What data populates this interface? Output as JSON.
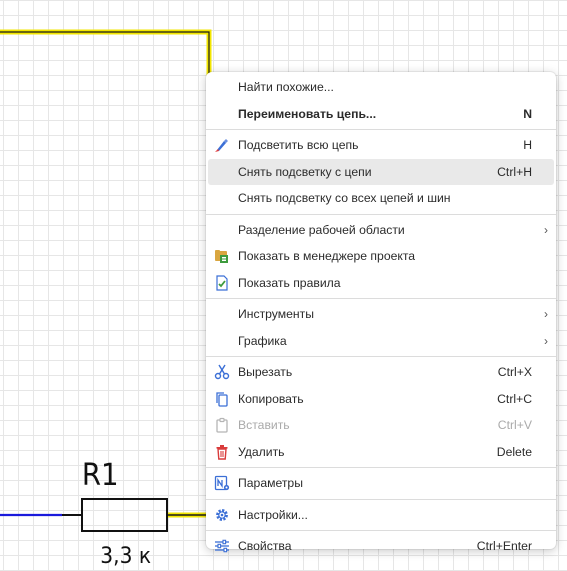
{
  "schematic": {
    "component_designator": "R1",
    "component_value": "3,3 к",
    "wire_highlight_color": "#f2e600",
    "wire_color_dark": "#1a1a1a",
    "net_color_blue": "#1a1adc"
  },
  "menu": {
    "find_similar": "Найти похожие...",
    "rename_net": "Переименовать цепь...",
    "rename_net_shortcut": "N",
    "highlight_net": "Подсветить всю цепь",
    "highlight_net_shortcut": "H",
    "clear_highlight_net": "Снять подсветку с цепи",
    "clear_highlight_net_shortcut": "Ctrl+H",
    "clear_highlight_all": "Снять подсветку со всех цепей и шин",
    "split_workspace": "Разделение рабочей области",
    "show_in_project_manager": "Показать в менеджере проекта",
    "show_rules": "Показать правила",
    "tools": "Инструменты",
    "graphics": "Графика",
    "cut": "Вырезать",
    "cut_shortcut": "Ctrl+X",
    "copy": "Копировать",
    "copy_shortcut": "Ctrl+C",
    "paste": "Вставить",
    "paste_shortcut": "Ctrl+V",
    "delete": "Удалить",
    "delete_shortcut": "Delete",
    "parameters": "Параметры",
    "settings": "Настройки...",
    "properties": "Свойства",
    "properties_shortcut": "Ctrl+Enter",
    "submenu_arrow": "›"
  }
}
